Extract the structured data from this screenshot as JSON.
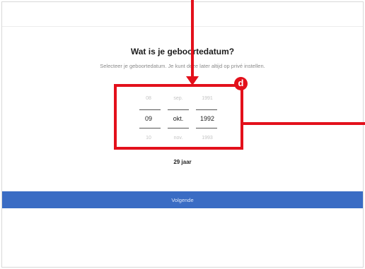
{
  "dialog": {
    "title": "Wat is je geboortedatum?",
    "subtitle": "Selecteer je geboortedatum. Je kunt deze later altijd op privé instellen."
  },
  "date_picker": {
    "previous": {
      "day": "08",
      "month": "sep.",
      "year": "1991"
    },
    "selected": {
      "day": "09",
      "month": "okt.",
      "year": "1992"
    },
    "next": {
      "day": "10",
      "month": "nov.",
      "year": "1993"
    }
  },
  "age_label": "29 jaar",
  "next_button_label": "Volgende",
  "annotation": {
    "badge_label": "d",
    "color": "#e3101b"
  },
  "colors": {
    "button_bg": "#3a6cc4",
    "annotation": "#e3101b"
  }
}
